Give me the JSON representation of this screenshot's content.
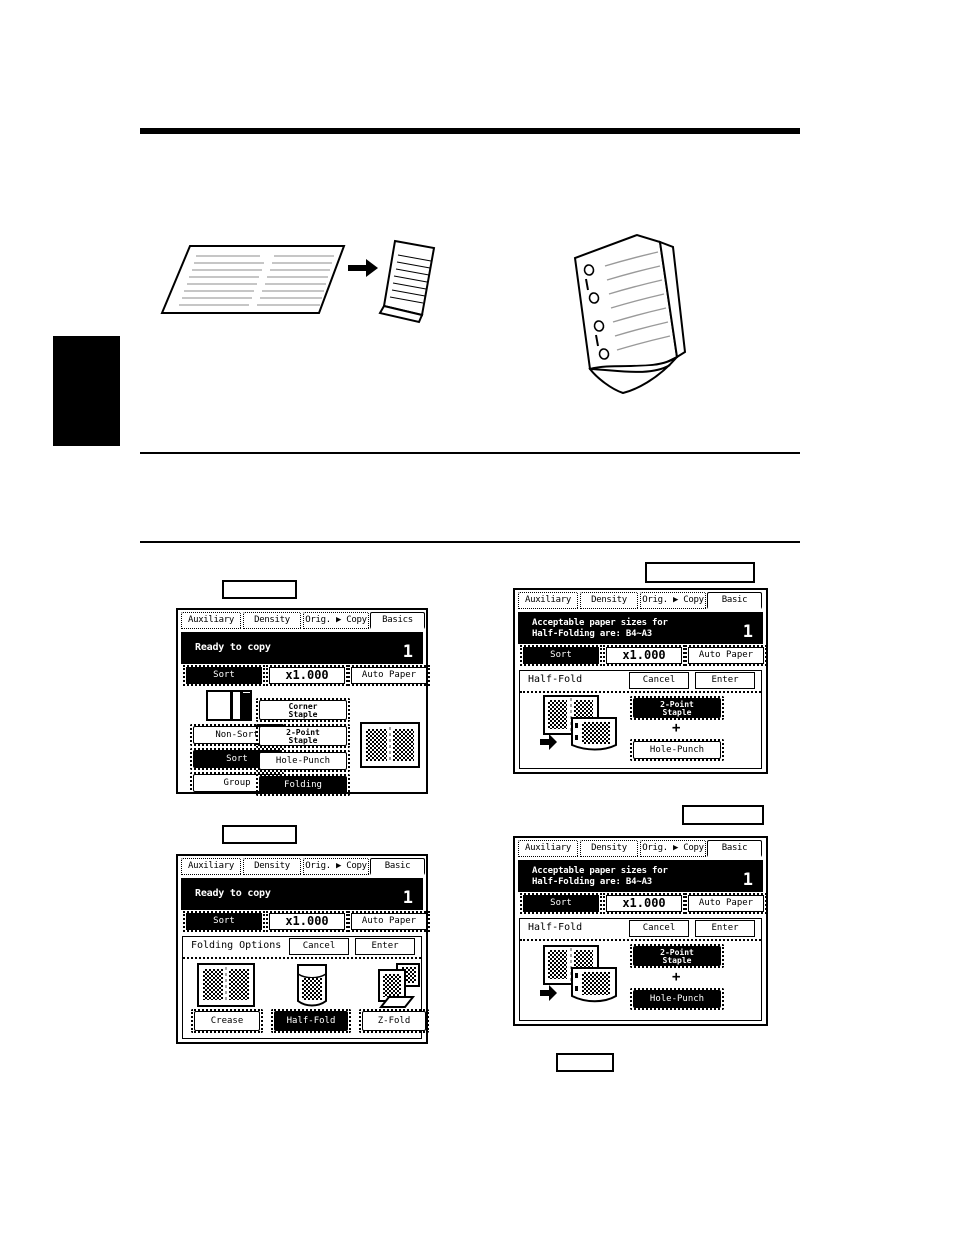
{
  "document": {
    "illustrations": [
      {
        "name": "sheet-to-halffold-diagram",
        "desc": "flat document sheet with arrow to a folded sheet"
      },
      {
        "name": "folded-punched-booklet",
        "desc": "half-folded booklet with four punched holes"
      }
    ]
  },
  "callout_boxes": [
    {
      "id": "callout-1",
      "text": ""
    },
    {
      "id": "callout-2",
      "text": ""
    },
    {
      "id": "callout-3",
      "text": ""
    },
    {
      "id": "callout-4",
      "text": ""
    },
    {
      "id": "callout-5",
      "text": ""
    }
  ],
  "panels": [
    {
      "id": "panel-1",
      "tabs": [
        {
          "label": "Auxiliary",
          "active": false
        },
        {
          "label": "Density",
          "active": false
        },
        {
          "label": "Orig. ▶ Copy",
          "active": false
        },
        {
          "label": "Basics",
          "active": true
        }
      ],
      "message": "Ready to copy",
      "count": "1",
      "status_buttons": [
        {
          "label": "Sort",
          "selected": true
        },
        {
          "label": "x1.000",
          "selected": false
        },
        {
          "label": "Auto Paper",
          "selected": false
        }
      ],
      "sort_options": [
        {
          "label": "Non-Sort",
          "selected": false
        },
        {
          "label": "Sort",
          "selected": true
        },
        {
          "label": "Group",
          "selected": false
        }
      ],
      "finish_options": [
        {
          "label": "Corner Staple",
          "line1": "Corner",
          "line2": "Staple",
          "selected": false
        },
        {
          "label": "2-Point Staple",
          "line1": "2-Point",
          "line2": "Staple",
          "selected": false
        },
        {
          "label": "Hole-Punch",
          "line1": "Hole-Punch",
          "line2": "",
          "selected": false
        },
        {
          "label": "Folding",
          "line1": "Folding",
          "line2": "",
          "selected": true
        }
      ],
      "preview_icon": "crease-preview-icon"
    },
    {
      "id": "panel-2",
      "tabs": [
        {
          "label": "Auxiliary",
          "active": false
        },
        {
          "label": "Density",
          "active": false
        },
        {
          "label": "Orig. ▶ Copy",
          "active": false
        },
        {
          "label": "Basic",
          "active": true
        }
      ],
      "message": "Acceptable paper sizes for\nHalf-Folding are: B4~A3",
      "count": "1",
      "status_buttons": [
        {
          "label": "Sort",
          "selected": true
        },
        {
          "label": "x1.000",
          "selected": false
        },
        {
          "label": "Auto Paper",
          "selected": false
        }
      ],
      "dialog": {
        "title": "Half-Fold",
        "cancel": "Cancel",
        "enter": "Enter",
        "plus": "+",
        "preview_icon": "halffold-staple-preview-icon",
        "buttons": [
          {
            "line1": "2-Point",
            "line2": "Staple",
            "label": "2-Point Staple",
            "selected": true
          },
          {
            "line1": "Hole-Punch",
            "line2": "",
            "label": "Hole-Punch",
            "selected": false
          }
        ]
      }
    },
    {
      "id": "panel-3",
      "tabs": [
        {
          "label": "Auxiliary",
          "active": false
        },
        {
          "label": "Density",
          "active": false
        },
        {
          "label": "Orig. ▶ Copy",
          "active": false
        },
        {
          "label": "Basic",
          "active": true
        }
      ],
      "message": "Ready to copy",
      "count": "1",
      "status_buttons": [
        {
          "label": "Sort",
          "selected": true
        },
        {
          "label": "x1.000",
          "selected": false
        },
        {
          "label": "Auto Paper",
          "selected": false
        }
      ],
      "dialog": {
        "title": "Folding Options",
        "cancel": "Cancel",
        "enter": "Enter",
        "buttons": [
          {
            "label": "Crease",
            "selected": false,
            "icon": "crease-icon"
          },
          {
            "label": "Half-Fold",
            "selected": true,
            "icon": "half-fold-icon"
          },
          {
            "label": "Z-Fold",
            "selected": false,
            "icon": "z-fold-icon"
          }
        ]
      }
    },
    {
      "id": "panel-4",
      "tabs": [
        {
          "label": "Auxiliary",
          "active": false
        },
        {
          "label": "Density",
          "active": false
        },
        {
          "label": "Orig. ▶ Copy",
          "active": false
        },
        {
          "label": "Basic",
          "active": true
        }
      ],
      "message": "Acceptable paper sizes for\nHalf-Folding are: B4~A3",
      "count": "1",
      "status_buttons": [
        {
          "label": "Sort",
          "selected": true
        },
        {
          "label": "x1.000",
          "selected": false
        },
        {
          "label": "Auto Paper",
          "selected": false
        }
      ],
      "dialog": {
        "title": "Half-Fold",
        "cancel": "Cancel",
        "enter": "Enter",
        "plus": "+",
        "preview_icon": "halffold-punch-preview-icon",
        "buttons": [
          {
            "line1": "2-Point",
            "line2": "Staple",
            "label": "2-Point Staple",
            "selected": true
          },
          {
            "line1": "Hole-Punch",
            "line2": "",
            "label": "Hole-Punch",
            "selected": true
          }
        ]
      }
    }
  ]
}
